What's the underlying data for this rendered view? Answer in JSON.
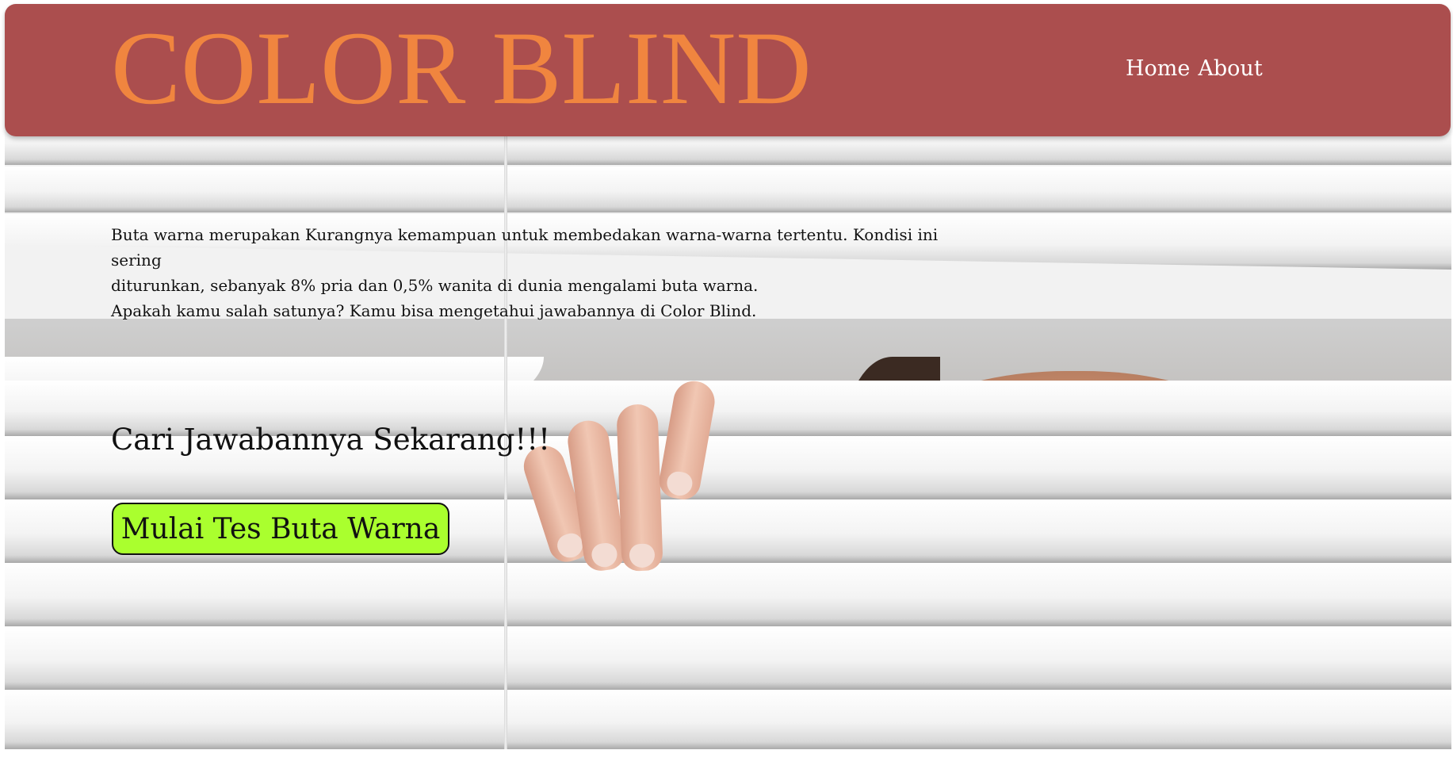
{
  "header": {
    "logo": "COLOR BLIND",
    "nav": {
      "home_label": "Home",
      "about_label": "About"
    }
  },
  "hero": {
    "intro_line_1": "Buta warna merupakan Kurangnya kemampuan untuk membedakan warna-warna tertentu. Kondisi ini sering",
    "intro_line_2": "diturunkan, sebanyak 8% pria dan 0,5% wanita di dunia mengalami buta warna.",
    "intro_line_3": "Apakah kamu salah satunya? Kamu bisa mengetahui jawabannya di Color Blind.",
    "cta_heading": "Cari Jawabannya Sekarang!!!",
    "cta_button_label": "Mulai Tes Buta Warna",
    "background_image": "woman-peeking-through-window-blinds"
  },
  "colors": {
    "header_background": "#ab4e4e",
    "logo_color": "#f0853f",
    "nav_text": "#ffffff",
    "button_background": "#aaff2e"
  }
}
